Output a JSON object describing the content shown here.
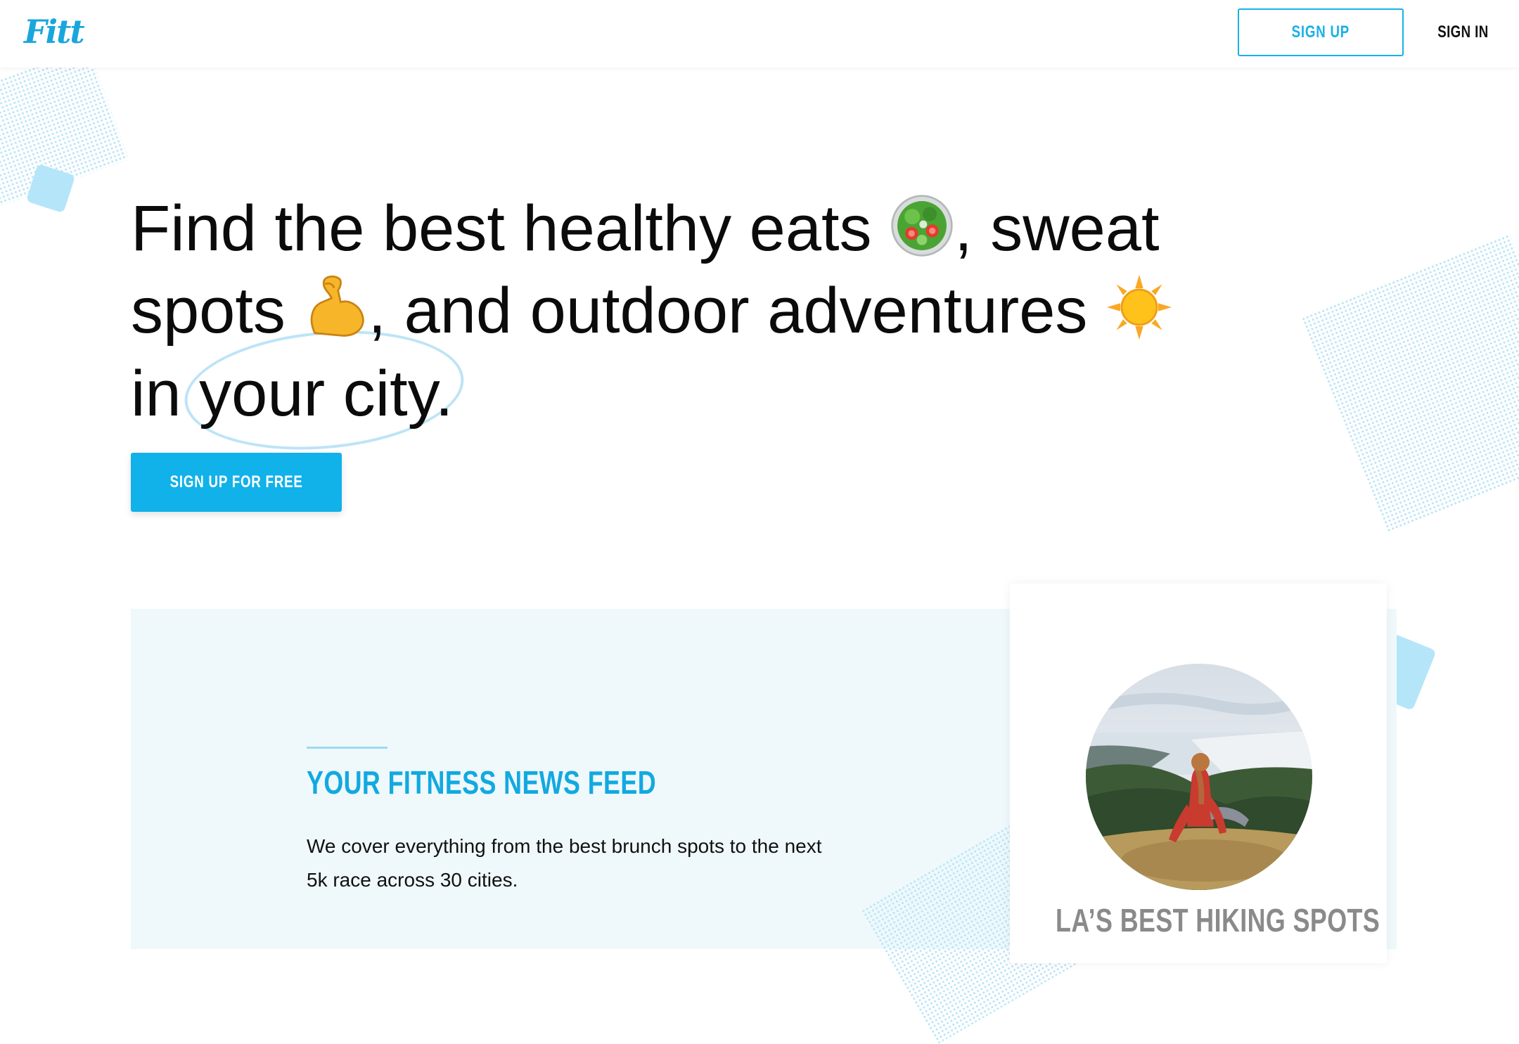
{
  "header": {
    "logo": "Fitt",
    "signup_label": "SIGN UP",
    "signin_label": "SIGN IN"
  },
  "hero": {
    "line1": "Find the best healthy eats",
    "line1_tail": ", sweat",
    "line2_start": "spots",
    "line2_mid": ", and outdoor adventures",
    "line3_start": "in ",
    "line3_circled": "your city",
    "line3_end": ".",
    "emojis": [
      "salad-icon",
      "flexed-biceps-icon",
      "sun-icon"
    ],
    "cta_label": "SIGN UP FOR FREE"
  },
  "feature": {
    "title": "YOUR FITNESS NEWS FEED",
    "description": "We cover everything from the best brunch spots to the next 5k race across 30 cities."
  },
  "card": {
    "title": "LA’S BEST HIKING SPOTS"
  },
  "colors": {
    "accent": "#11b1ea",
    "accent_light": "#b5e5f8",
    "panel_bg": "#eff9fc",
    "card_title": "#8a8a8a"
  }
}
